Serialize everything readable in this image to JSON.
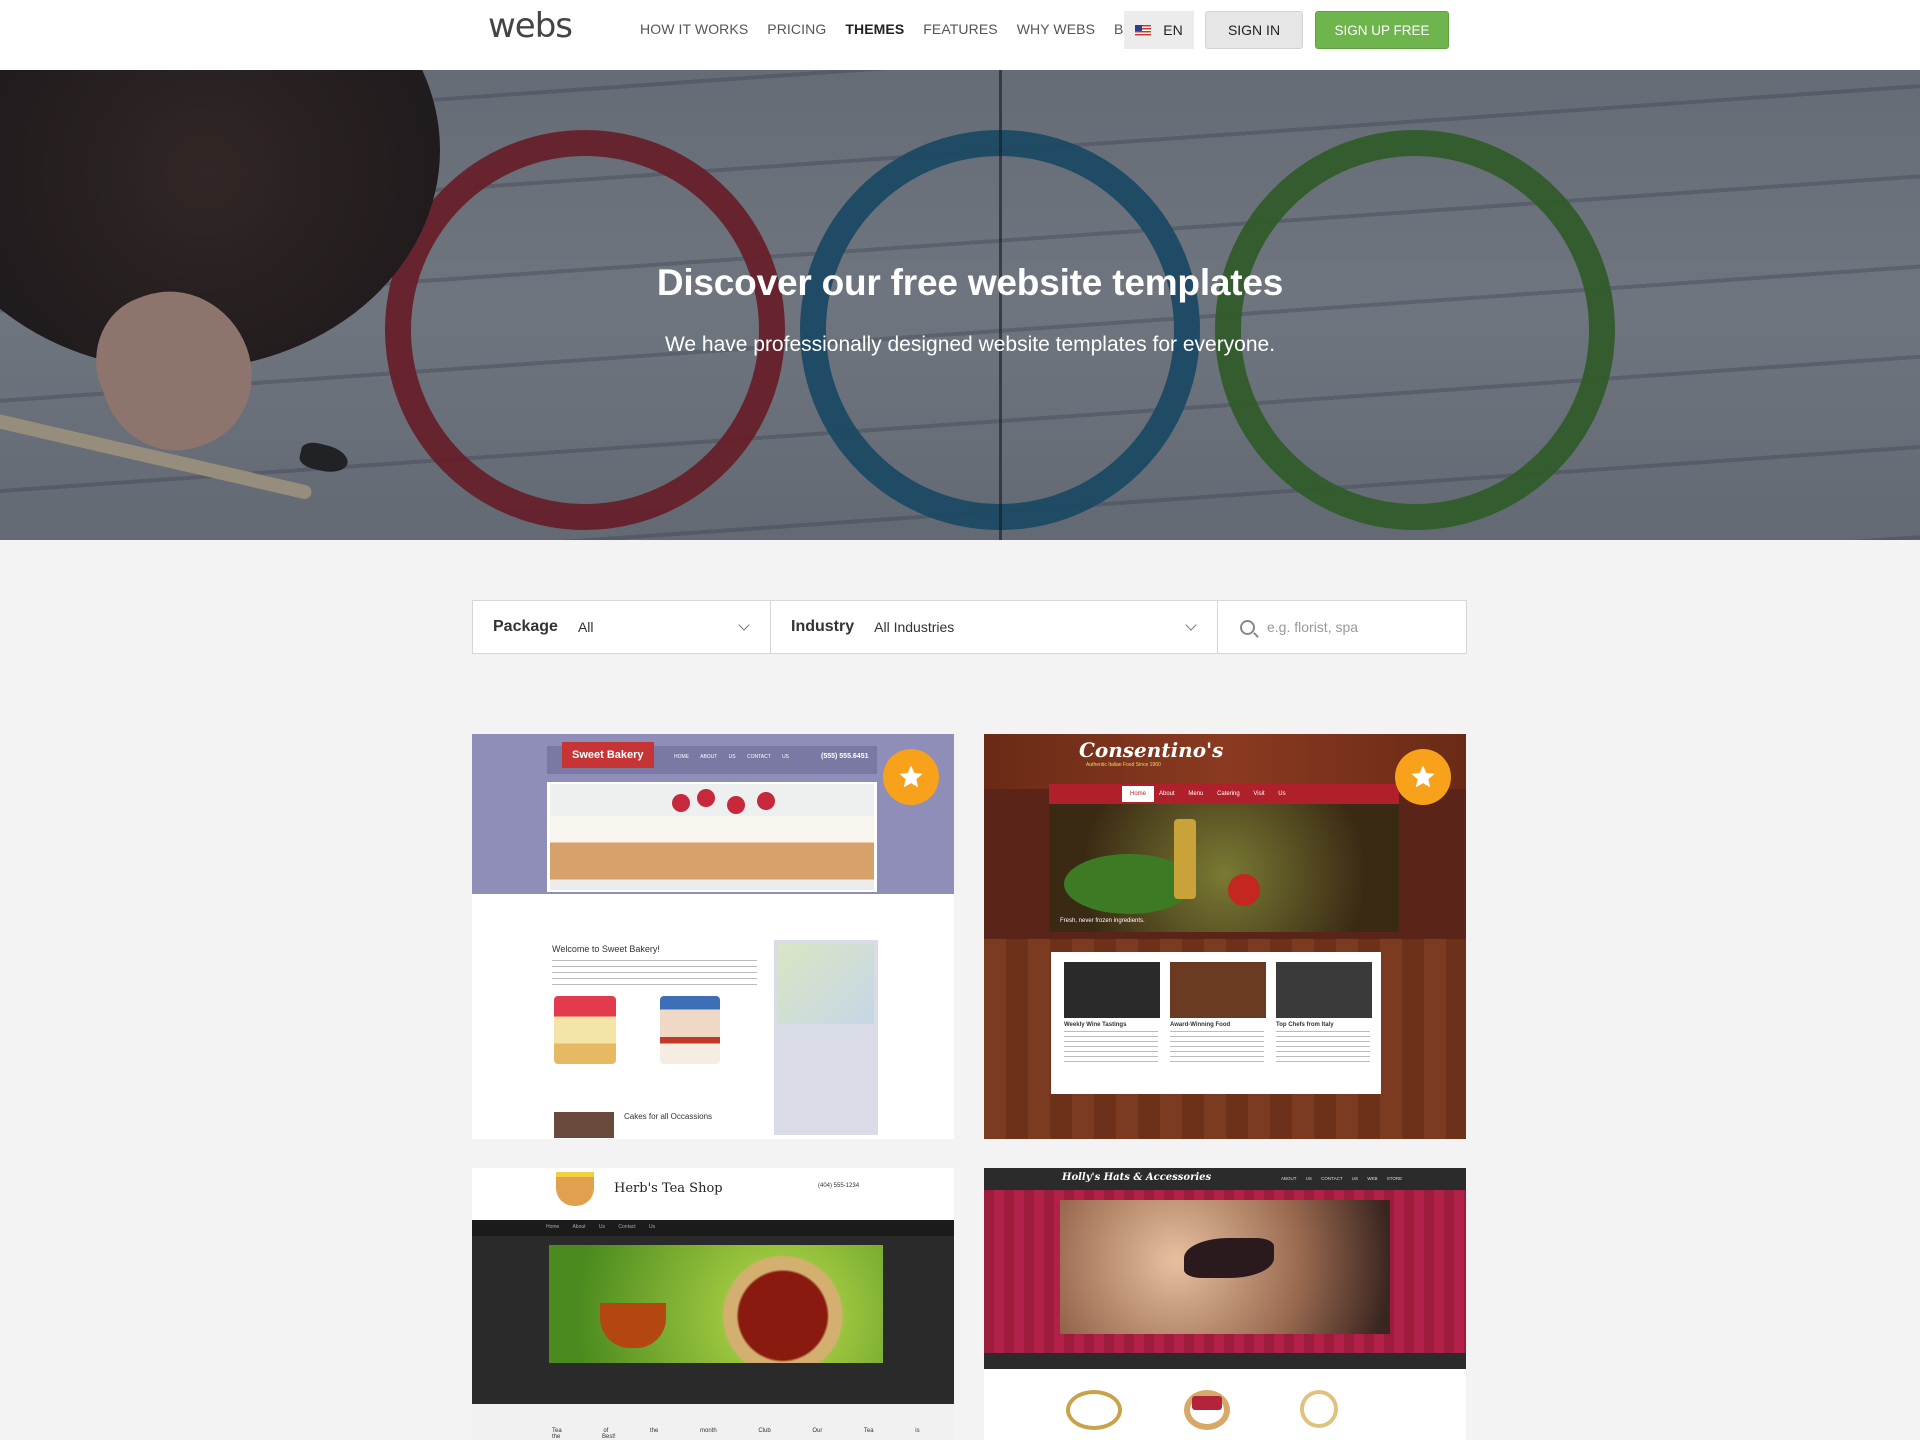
{
  "nav": {
    "logo": "webs",
    "links": [
      "HOW IT WORKS",
      "PRICING",
      "THEMES",
      "FEATURES",
      "WHY WEBS",
      "BLOG"
    ],
    "active_link": "THEMES",
    "language": "EN",
    "sign_in": "SIGN IN",
    "sign_up": "SIGN UP FREE"
  },
  "hero": {
    "title": "Discover our free website templates",
    "subtitle": "We have professionally designed website templates for everyone."
  },
  "filters": {
    "package_label": "Package",
    "package_value": "All",
    "industry_label": "Industry",
    "industry_value": "All Industries",
    "search_placeholder": "e.g. florist, spa"
  },
  "templates": [
    {
      "name": "Sweet Bakery",
      "featured": true,
      "phone": "(555) 555.6451",
      "menu": "HOME ABOUT US CONTACT US",
      "welcome": "Welcome to Sweet Bakery!",
      "section": "Cakes for all Occassions"
    },
    {
      "name": "Consentino's",
      "featured": true,
      "tagline": "Authentic Italian Food Since 1960",
      "nav": [
        "Home",
        "About",
        "Menu",
        "Catering",
        "Visit Us"
      ],
      "caption": "Fresh, never frozen ingredients.",
      "features": [
        "Weekly Wine Tastings",
        "Award-Winning Food",
        "Top Chefs from Italy"
      ]
    },
    {
      "name": "Herb's Tea Shop",
      "featured": false,
      "phone": "(404) 555-1234",
      "nav": "Home About Us Contact Us",
      "footer": "Tea of the month Club Our Tea is the Best!"
    },
    {
      "name": "Holly's Hats & Accessories",
      "featured": false,
      "nav": "ABOUT US CONTACT US WEB STORE"
    }
  ],
  "colors": {
    "signup_green": "#6fb54e",
    "featured_orange": "#f7a21a",
    "page_bg": "#f3f3f3"
  }
}
